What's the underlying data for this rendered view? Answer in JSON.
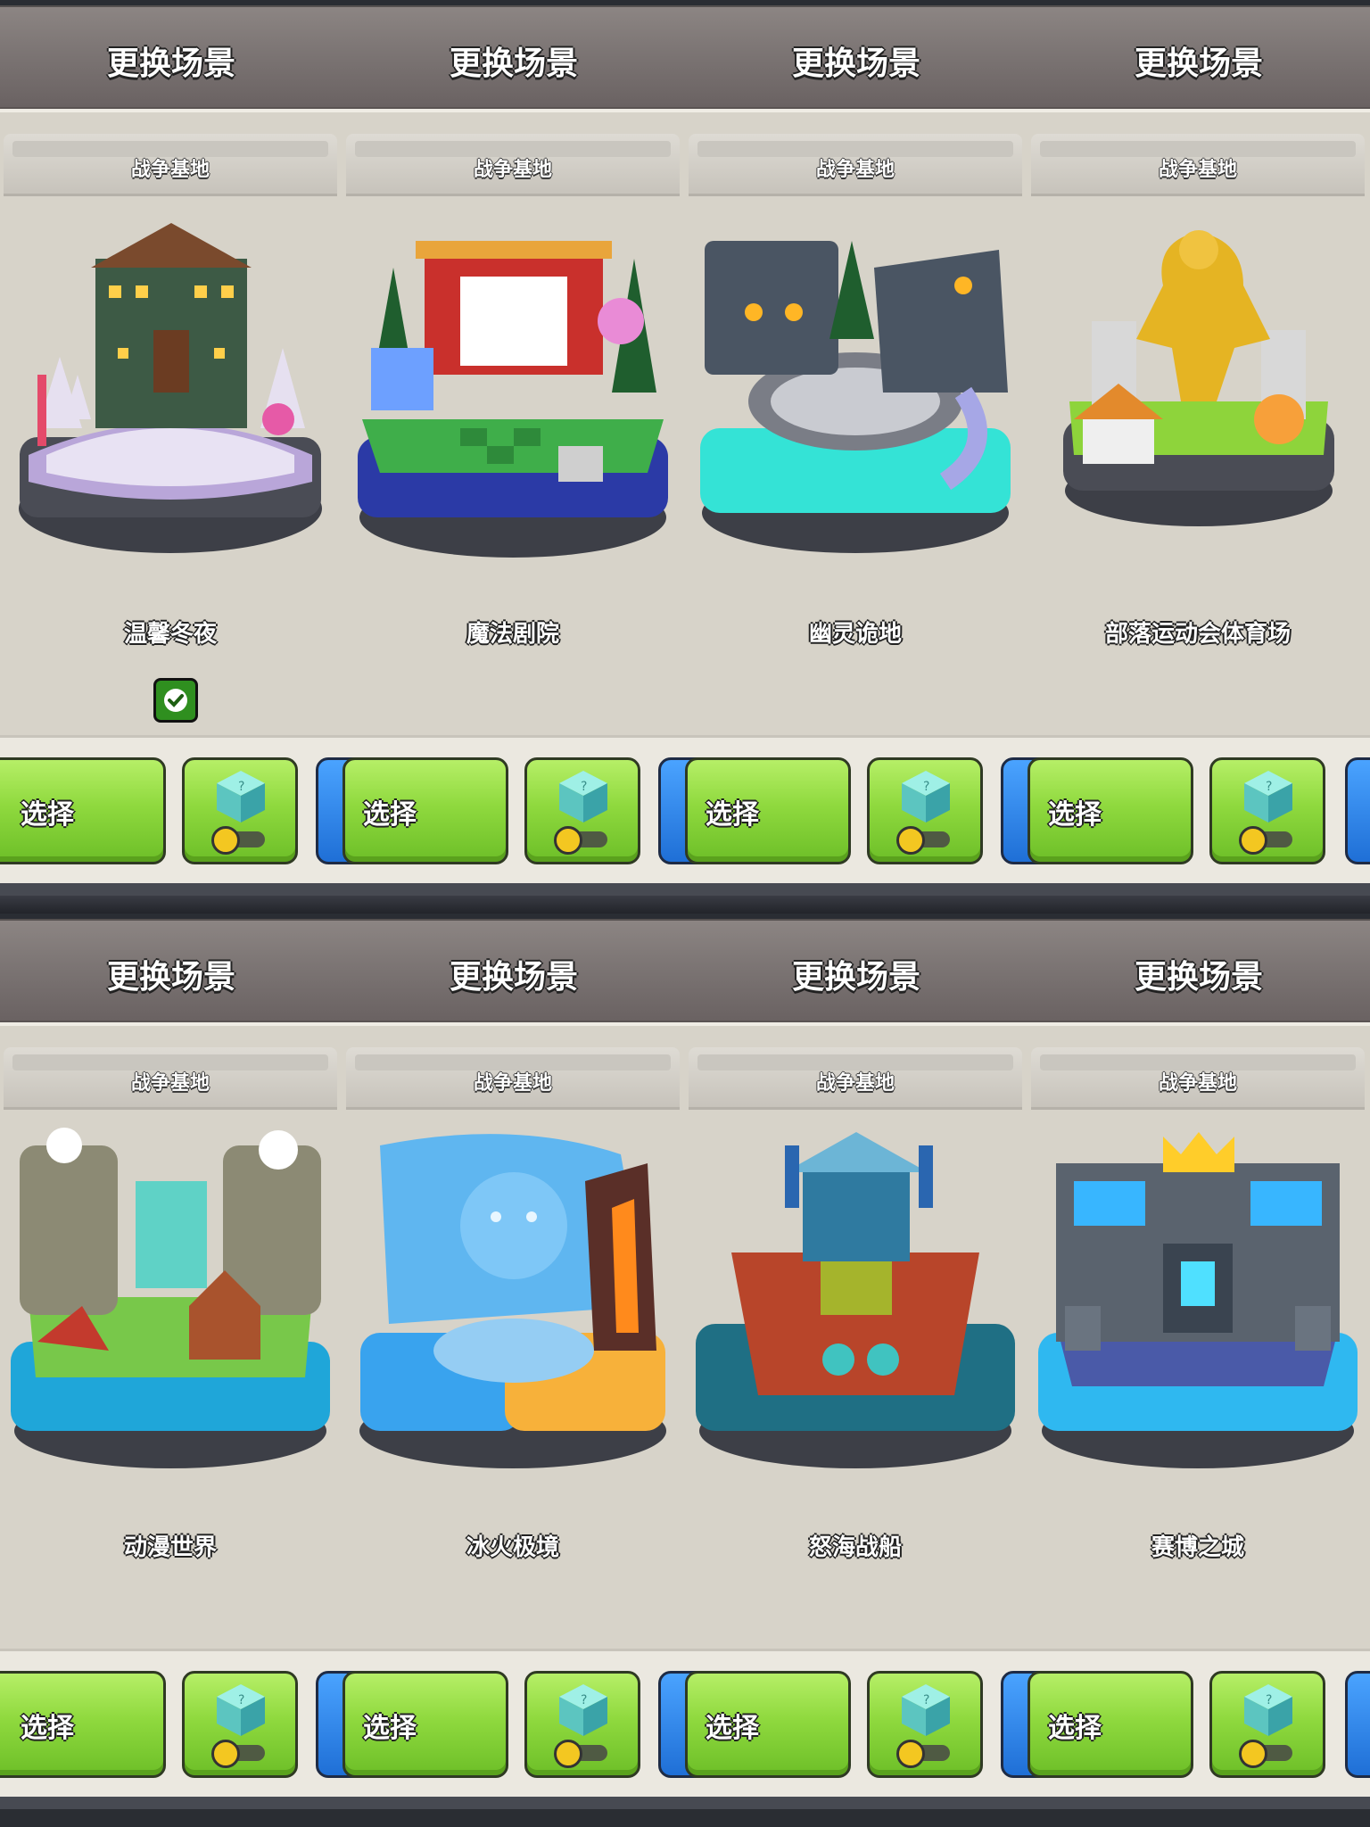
{
  "header": {
    "title": "更换场景"
  },
  "card_tab_label": "战争基地",
  "buttons": {
    "select_label": "选择"
  },
  "panels": [
    {
      "scenes": [
        {
          "name": "温馨冬夜",
          "theme": "winter-cabin",
          "selected": true
        },
        {
          "name": "魔法剧院",
          "theme": "magic-theater",
          "selected": false
        },
        {
          "name": "幽灵诡地",
          "theme": "ghost-land",
          "selected": false
        },
        {
          "name": "部落运动会体育场",
          "theme": "golden-stadium",
          "selected": false
        }
      ]
    },
    {
      "scenes": [
        {
          "name": "动漫世界",
          "theme": "anime-world",
          "selected": false
        },
        {
          "name": "冰火极境",
          "theme": "ice-fire",
          "selected": false
        },
        {
          "name": "怒海战船",
          "theme": "war-ship",
          "selected": false
        },
        {
          "name": "赛博之城",
          "theme": "cyber-city",
          "selected": false
        }
      ]
    }
  ],
  "icons": {
    "selected_check": "check-icon",
    "random_box": "mystery-cube-icon",
    "toggle": "toggle-switch-icon"
  },
  "colors": {
    "header": "#7c7574",
    "card_bg": "#d7d3c9",
    "button_green": "#8fd93e",
    "button_blue": "#1f6fd6",
    "check_green": "#2f8f1f"
  }
}
